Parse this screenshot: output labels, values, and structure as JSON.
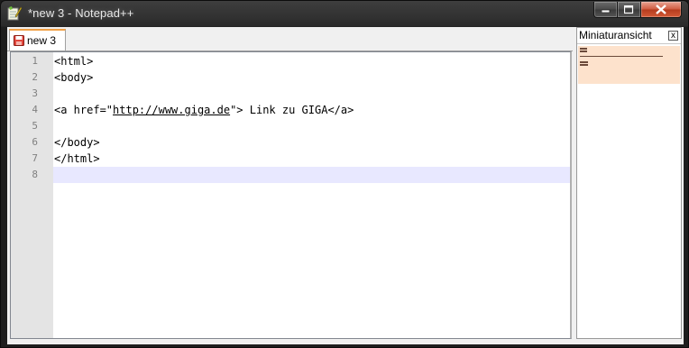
{
  "window": {
    "title": "*new 3 - Notepad++"
  },
  "tabs": [
    {
      "label": "new 3",
      "icon": "save-disk-red-icon"
    }
  ],
  "editor": {
    "lines": [
      {
        "number": "1",
        "text": "<html>"
      },
      {
        "number": "2",
        "text": "<body>"
      },
      {
        "number": "3",
        "text": ""
      },
      {
        "number": "4",
        "text_before": "<a href=\"",
        "url": "http://www.giga.de",
        "text_after": "\"> Link zu GIGA</a>"
      },
      {
        "number": "5",
        "text": ""
      },
      {
        "number": "6",
        "text": "</body>"
      },
      {
        "number": "7",
        "text": "</html>"
      },
      {
        "number": "8",
        "text": ""
      }
    ],
    "current_line": 8
  },
  "panel": {
    "title": "Miniaturansicht",
    "close_label": "x"
  },
  "colors": {
    "tab_accent": "#f1a046",
    "current_line": "#e8e8ff",
    "gutter": "#e4e4e4",
    "minimap_view": "#fde2cc",
    "close_button": "#c44a2a"
  }
}
